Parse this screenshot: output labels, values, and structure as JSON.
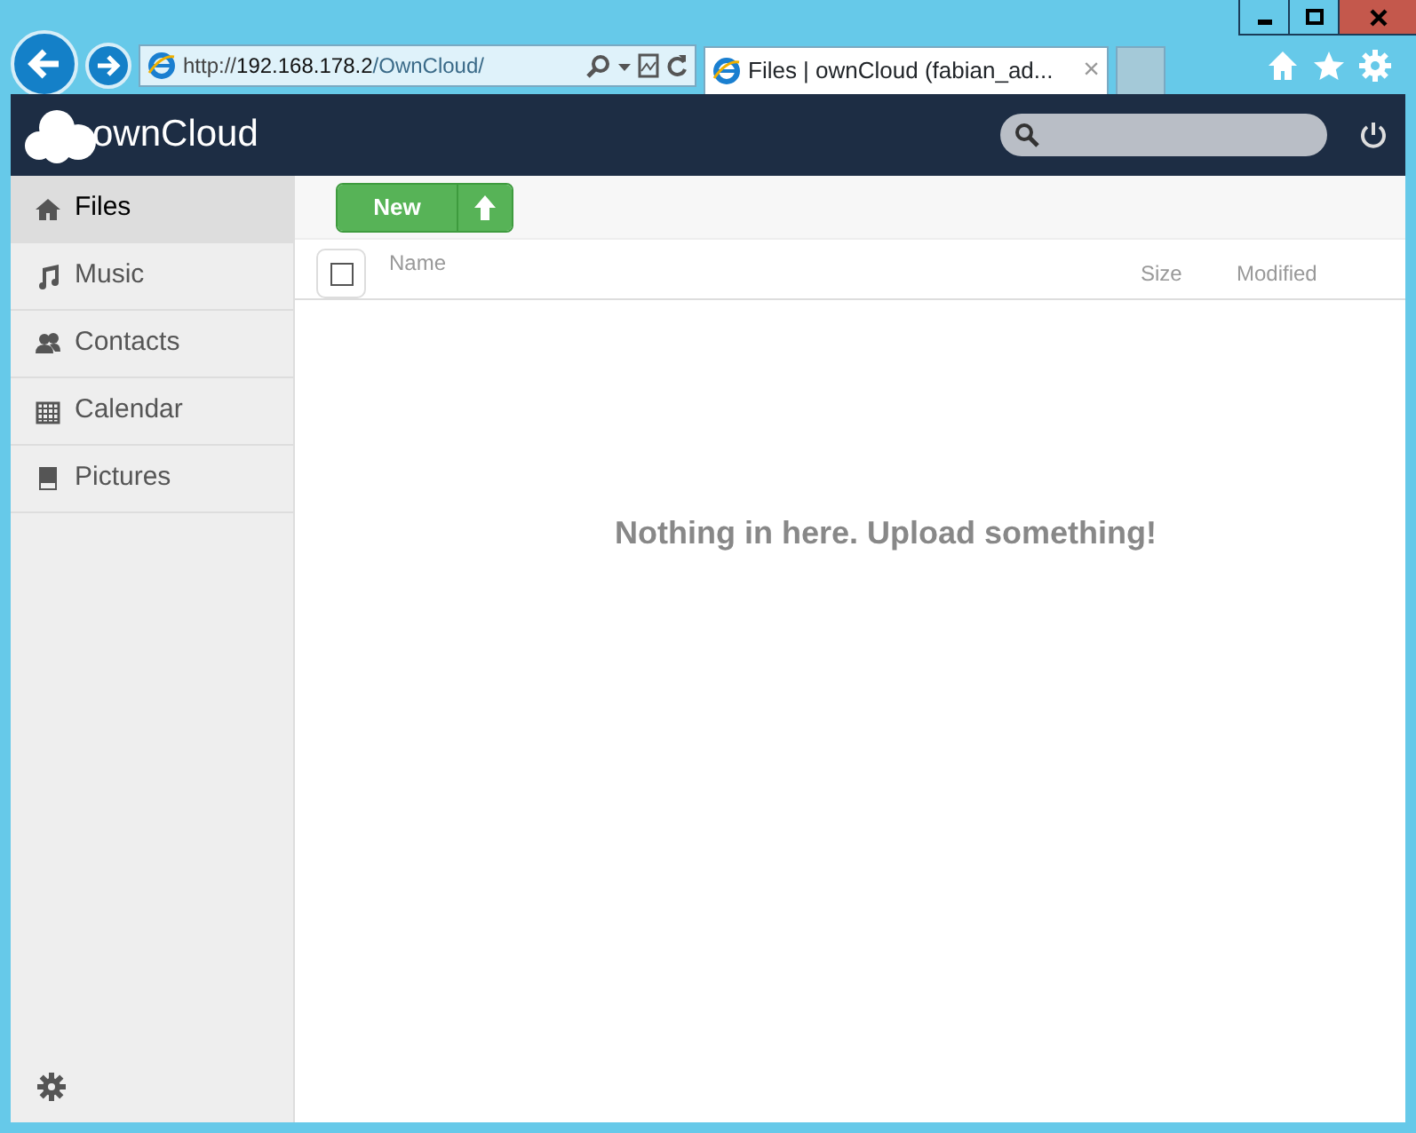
{
  "browser": {
    "address": {
      "scheme": "http://",
      "host": "192.168.178.2",
      "path": "/OwnCloud/"
    },
    "tabs": [
      {
        "title": "Files | ownCloud (fabian_ad...",
        "close": "×",
        "selected": true
      }
    ]
  },
  "app": {
    "logo": "ownCloud",
    "sidebar": {
      "items": [
        {
          "label": "Files",
          "selected": true
        },
        {
          "label": "Music",
          "selected": false
        },
        {
          "label": "Contacts",
          "selected": false
        },
        {
          "label": "Calendar",
          "selected": false
        },
        {
          "label": "Pictures",
          "selected": false
        }
      ]
    },
    "toolbar": {
      "new_button": "New"
    },
    "table": {
      "select_all": {
        "checked": false
      },
      "columns": [
        "Name",
        "Size",
        "Modified"
      ]
    },
    "empty_message": "Nothing in here. Upload something!"
  }
}
